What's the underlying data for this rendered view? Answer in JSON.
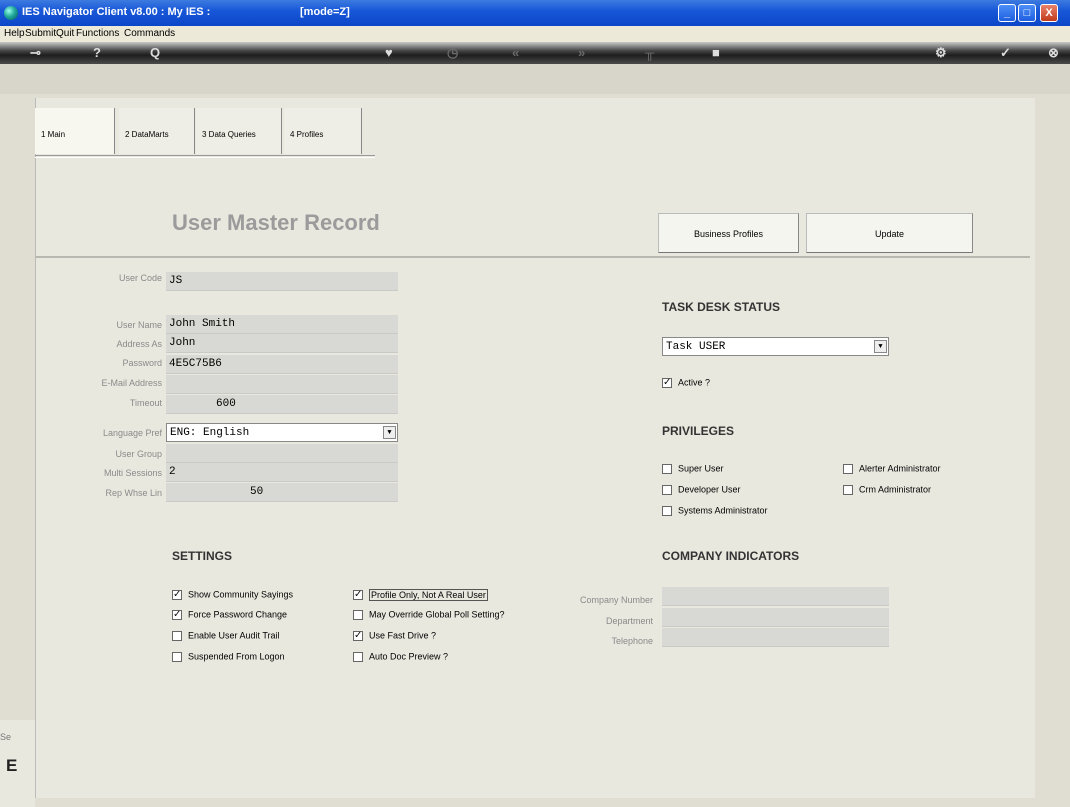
{
  "window": {
    "title": "IES Navigator Client v8.00 : My IES :",
    "mode": "[mode=Z]",
    "controls": {
      "minimize": "_",
      "maximize": "□",
      "close": "X"
    }
  },
  "menu": [
    "Help",
    "Submit",
    "Quit",
    "Functions",
    "Commands"
  ],
  "toolbar": {
    "icons": [
      "key-icon",
      "help-icon",
      "search-icon",
      "heart-icon",
      "clock-icon",
      "back-icon",
      "forward-icon",
      "tree-icon",
      "stop-icon",
      "settings-icon",
      "ok-icon",
      "exit-icon"
    ],
    "glyphs": [
      "⊸",
      "?",
      "Q",
      "♥",
      "◷",
      "«",
      "»",
      "╥",
      "■",
      "⚙",
      "✓",
      "⊗"
    ]
  },
  "tabs": [
    "1 Main",
    "2 DataMarts",
    "3 Data Queries",
    "4 Profiles"
  ],
  "page_title": "User Master Record",
  "buttons": {
    "business_profiles": "Business Profiles",
    "update": "Update"
  },
  "user": {
    "code_label": "User Code",
    "code": "JS",
    "name_label": "User Name",
    "name": "John Smith",
    "address_label": "Address As",
    "address": "John",
    "password_label": "Password",
    "password": "4E5C75B6",
    "email_label": "E-Mail Address",
    "email": "",
    "timeout_label": "Timeout",
    "timeout": "600",
    "language_label": "Language Pref",
    "language": "ENG: English",
    "group_label": "User Group",
    "group": "",
    "multi_label": "Multi Sessions",
    "multi": "2",
    "rep_label": "Rep Whse Lin",
    "rep": "50"
  },
  "task_desk": {
    "title": "TASK DESK STATUS",
    "value": "Task USER",
    "active_label": "Active ?",
    "active": true
  },
  "privileges": {
    "title": "PRIVILEGES",
    "super_user": "Super User",
    "developer_user": "Developer User",
    "systems_admin": "Systems Administrator",
    "alerter_admin": "Alerter Administrator",
    "crm_admin": "Crm Administrator"
  },
  "settings": {
    "title": "SETTINGS",
    "show_sayings": "Show Community Sayings",
    "force_password": "Force Password Change",
    "audit_trail": "Enable User Audit Trail",
    "suspended": "Suspended From Logon",
    "profile_only": "Profile Only, Not A Real User",
    "override_poll": "May Override Global Poll Setting?",
    "fast_drive": "Use Fast Drive ?",
    "auto_doc": "Auto Doc Preview ?"
  },
  "company": {
    "title": "COMPANY INDICATORS",
    "number_label": "Company Number",
    "department_label": "Department",
    "telephone_label": "Telephone"
  },
  "bottom": {
    "se": "Se",
    "e": "E"
  }
}
